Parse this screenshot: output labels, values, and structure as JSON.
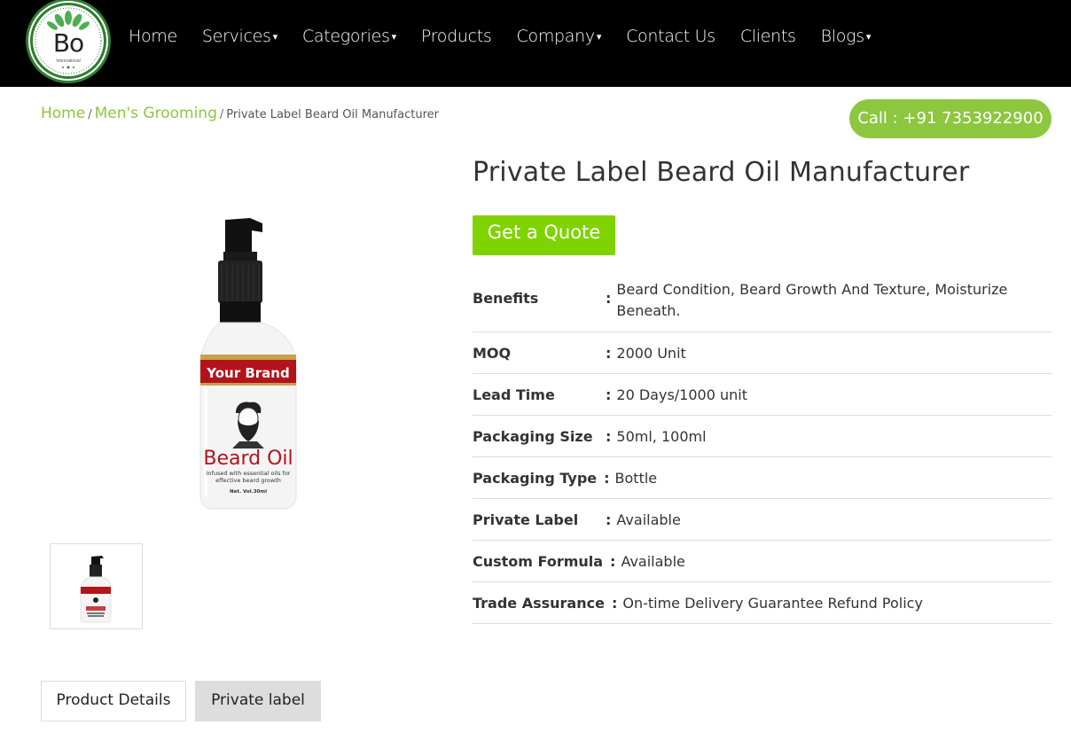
{
  "header": {
    "logo_text": "Bo",
    "logo_sub": "International",
    "nav": [
      {
        "label": "Home",
        "dropdown": false
      },
      {
        "label": "Services",
        "dropdown": true
      },
      {
        "label": "Categories",
        "dropdown": true
      },
      {
        "label": "Products",
        "dropdown": false
      },
      {
        "label": "Company",
        "dropdown": true
      },
      {
        "label": "Contact Us",
        "dropdown": false
      },
      {
        "label": "Clients",
        "dropdown": false
      },
      {
        "label": "Blogs",
        "dropdown": true
      }
    ]
  },
  "breadcrumb": {
    "home": "Home",
    "category": "Men's Grooming",
    "current": "Private Label Beard Oil Manufacturer"
  },
  "call_button": "Call : +91 7353922900",
  "product": {
    "title": "Private Label Beard Oil Manufacturer",
    "quote_button": "Get a Quote",
    "image": {
      "brand_band": "Your Brand",
      "product_name": "Beard Oil",
      "tagline_1": "Infused with essential oils for",
      "tagline_2": "effective beard growth",
      "volume": "Net. Vol.30ml"
    }
  },
  "specs": [
    {
      "label": "Benefits",
      "value": "Beard Condition, Beard Growth And Texture, Moisturize Beneath."
    },
    {
      "label": "MOQ",
      "value": "2000 Unit"
    },
    {
      "label": "Lead Time",
      "value": "20 Days/1000 unit"
    },
    {
      "label": "Packaging Size",
      "value": "50ml, 100ml"
    },
    {
      "label": "Packaging Type",
      "value": "Bottle"
    },
    {
      "label": "Private Label",
      "value": "Available"
    },
    {
      "label": "Custom Formula",
      "value": "Available"
    },
    {
      "label": "Trade Assurance",
      "value": "On-time Delivery Guarantee Refund Policy"
    }
  ],
  "tabs": [
    "Product Details",
    "Private label"
  ],
  "colors": {
    "accent_green": "#8dc63f",
    "quote_green": "#7fd300",
    "header_bg": "#000000",
    "brand_red": "#b3131b"
  }
}
